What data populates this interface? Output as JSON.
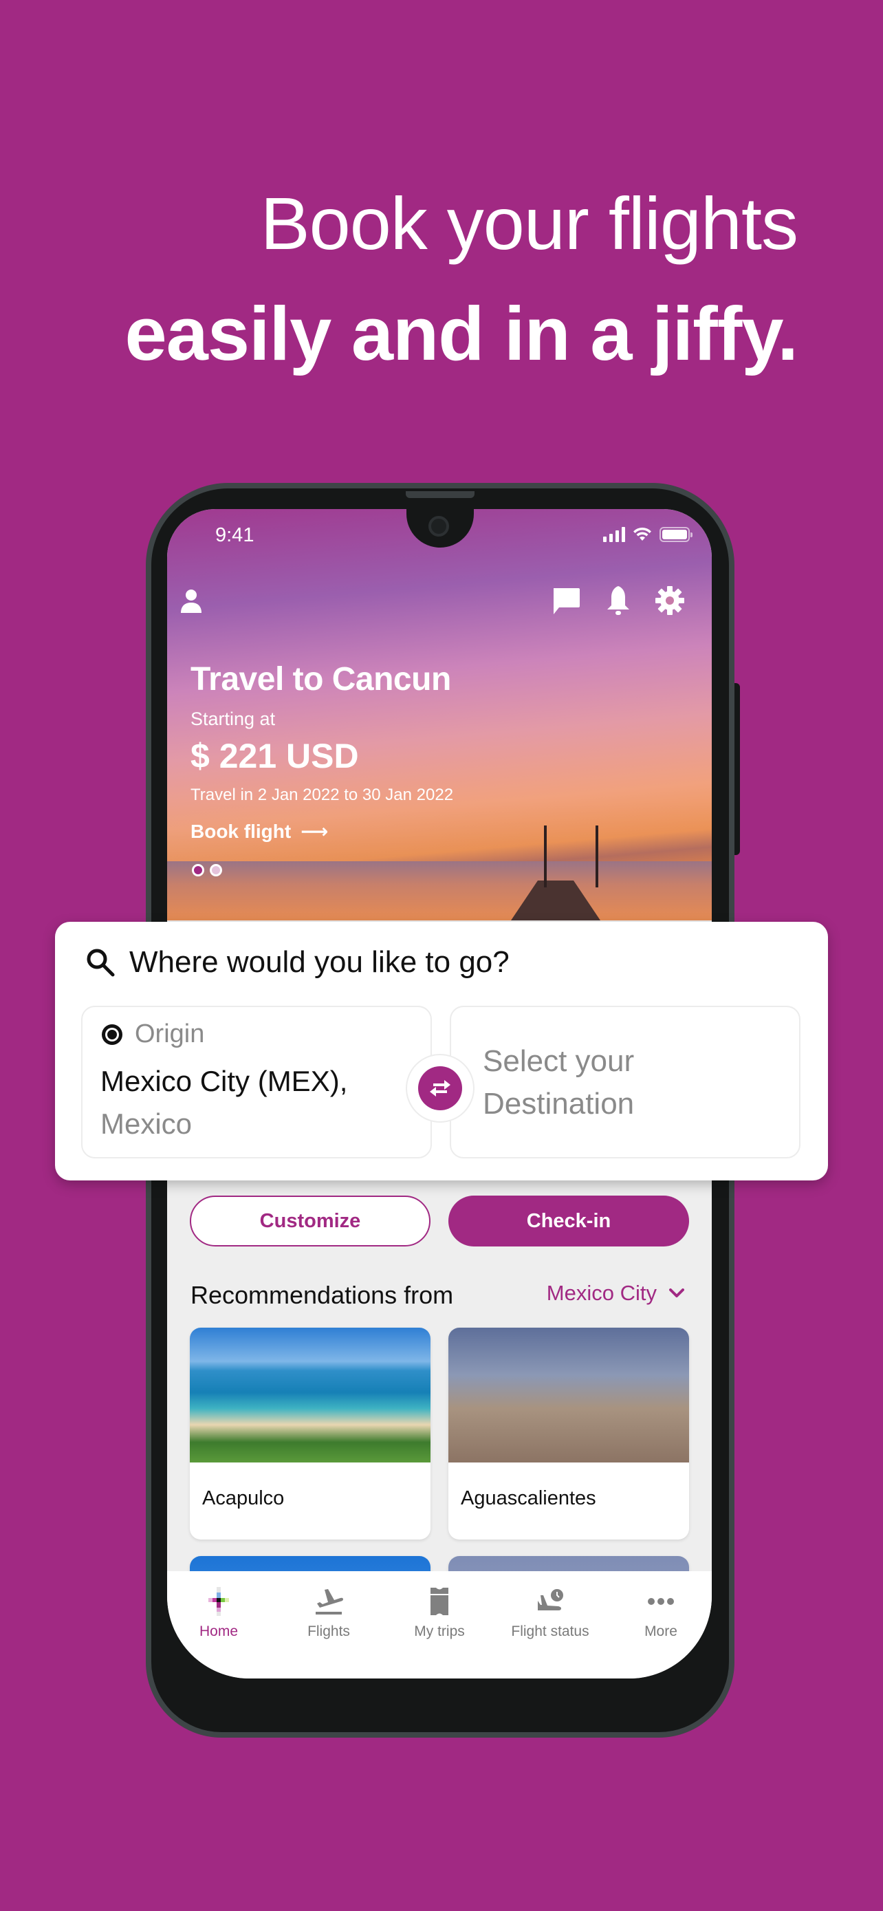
{
  "headline": {
    "line1": "Book your flights",
    "line2": "easily and in a jiffy."
  },
  "colors": {
    "brand": "#a12983",
    "background": "#a12983",
    "text_dark": "#111111",
    "text_muted": "#8a8a8a"
  },
  "status_bar": {
    "time": "9:41",
    "icons": [
      "signal-icon",
      "wifi-icon",
      "battery-icon"
    ]
  },
  "top_bar": {
    "left_icon": "profile-icon",
    "right_icons": [
      "chat-icon",
      "bell-icon",
      "gear-icon"
    ]
  },
  "hero": {
    "title": "Travel to Cancun",
    "subtitle": "Starting at",
    "price": "$ 221 USD",
    "dates": "Travel in 2 Jan 2022 to 30 Jan 2022",
    "cta": "Book flight",
    "cta_arrow": "⟶",
    "carousel": {
      "total": 2,
      "active": 1
    }
  },
  "search": {
    "prompt": "Where would you like to go?",
    "origin": {
      "label": "Origin",
      "city": "Mexico City (MEX),",
      "country": "Mexico"
    },
    "destination": {
      "placeholder": "Select your Destination"
    }
  },
  "actions": {
    "customize": "Customize",
    "checkin": "Check-in"
  },
  "recommendations": {
    "title": "Recommendations from",
    "city": "Mexico City",
    "items": [
      {
        "name": "Acapulco"
      },
      {
        "name": "Aguascalientes"
      }
    ]
  },
  "tabbar": {
    "items": [
      {
        "label": "Home",
        "icon": "home-icon",
        "active": true
      },
      {
        "label": "Flights",
        "icon": "plane-takeoff-icon",
        "active": false
      },
      {
        "label": "My trips",
        "icon": "ticket-icon",
        "active": false
      },
      {
        "label": "Flight status",
        "icon": "flight-status-icon",
        "active": false
      },
      {
        "label": "More",
        "icon": "more-icon",
        "active": false
      }
    ]
  }
}
